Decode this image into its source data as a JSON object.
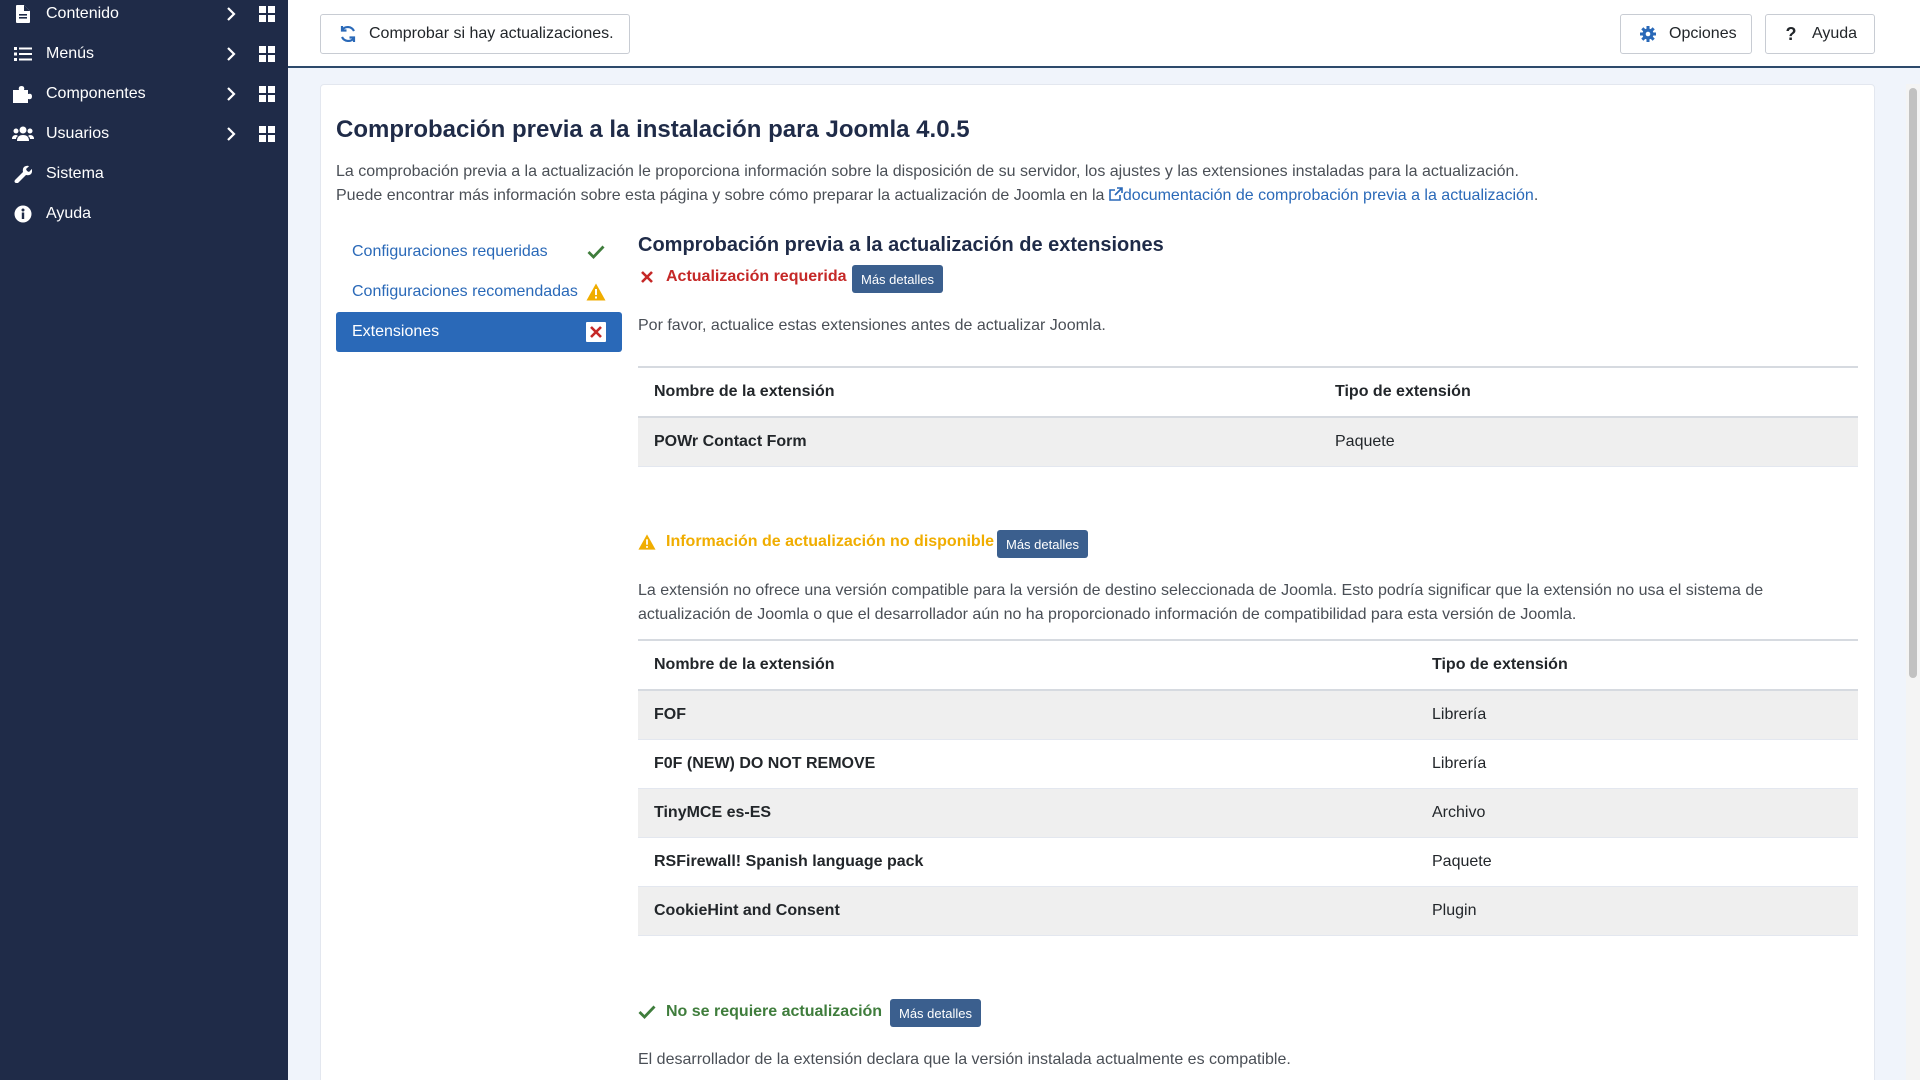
{
  "sidebar": {
    "items": [
      {
        "label": "Contenido",
        "icon": "file-icon",
        "has_submenu": true
      },
      {
        "label": "Menús",
        "icon": "list-icon",
        "has_submenu": true
      },
      {
        "label": "Componentes",
        "icon": "puzzle-icon",
        "has_submenu": true
      },
      {
        "label": "Usuarios",
        "icon": "users-icon",
        "has_submenu": true
      },
      {
        "label": "Sistema",
        "icon": "wrench-icon",
        "has_submenu": false
      },
      {
        "label": "Ayuda",
        "icon": "info-icon",
        "has_submenu": false
      }
    ]
  },
  "toolbar": {
    "check_updates_label": "Comprobar si hay actualizaciones.",
    "options_label": "Opciones",
    "help_label": "Ayuda"
  },
  "main": {
    "title": "Comprobación previa a la instalación para Joomla 4.0.5",
    "intro_line1": "La comprobación previa a la actualización le proporciona información sobre la disposición de su servidor, los ajustes y las extensiones instaladas para la actualización.",
    "intro_line2_prefix": "Puede encontrar más información sobre esta página y sobre cómo preparar la actualización de Joomla en la",
    "intro_link": "documentación de comprobación previa a la actualización",
    "intro_line2_suffix": ".",
    "tabs": [
      {
        "label": "Configuraciones requeridas",
        "status": "ok"
      },
      {
        "label": "Configuraciones recomendadas",
        "status": "warning"
      },
      {
        "label": "Extensiones",
        "status": "error"
      }
    ],
    "extensions_title": "Comprobación previa a la actualización de extensiones",
    "more_details_label": "Más detalles",
    "col_name": "Nombre de la extensión",
    "col_type": "Tipo de extensión",
    "required": {
      "label": "Actualización requerida",
      "description": "Por favor, actualice estas extensiones antes de actualizar Joomla.",
      "rows": [
        {
          "name": "POWr Contact Form",
          "type": "Paquete"
        }
      ]
    },
    "unavailable": {
      "label": "Información de actualización no disponible",
      "description_line1": "La extensión no ofrece una versión compatible para la versión de destino seleccionada de Joomla. Esto podría significar que la extensión no usa el sistema de",
      "description_line2": "actualización de Joomla o que el desarrollador aún no ha proporcionado información de compatibilidad para esta versión de Joomla.",
      "rows": [
        {
          "name": "FOF",
          "type": "Librería"
        },
        {
          "name": "F0F (NEW) DO NOT REMOVE",
          "type": "Librería"
        },
        {
          "name": "TinyMCE es-ES",
          "type": "Archivo"
        },
        {
          "name": "RSFirewall! Spanish language pack",
          "type": "Paquete"
        },
        {
          "name": "CookieHint and Consent",
          "type": "Plugin"
        }
      ]
    },
    "not_required": {
      "label": "No se requiere actualización",
      "description": "El desarrollador de la extensión declara que la versión instalada actualmente es compatible."
    }
  },
  "colors": {
    "sidebar_bg": "#1f2b48",
    "accent": "#2a69b8",
    "error": "#c52827",
    "warning": "#f0ad00",
    "success": "#3f7d3c"
  }
}
